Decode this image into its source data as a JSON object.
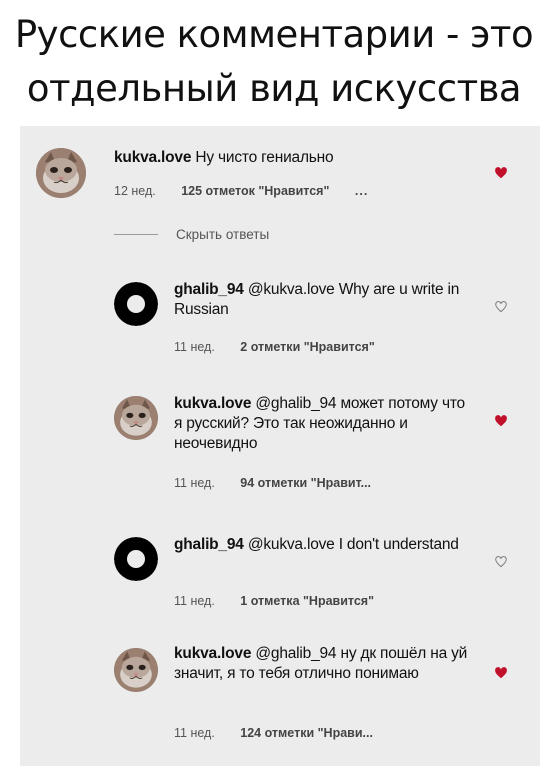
{
  "headline": {
    "line1": "Русские комментарии - это",
    "line2": "отдельный вид искусства"
  },
  "hide_replies_label": "Скрыть ответы",
  "comments": [
    {
      "username": "kukva.love",
      "text": "Ну чисто гениально",
      "time": "12 нед.",
      "likes": "125 отметок \"Нравится\"",
      "more": "...",
      "liked": true,
      "avatar": "cat-avatar"
    },
    {
      "username": "ghalib_94",
      "mention": "@kukva.love",
      "text": "Why are u write in Russian",
      "time": "11 нед.",
      "likes": "2 отметки \"Нравится\"",
      "liked": false,
      "avatar": "black-ring-avatar"
    },
    {
      "username": "kukva.love",
      "mention": "@ghalib_94",
      "text": "может потому что я русский? Это так неожиданно и неочевидно",
      "time": "11 нед.",
      "likes": "94 отметки \"Нравит...",
      "liked": true,
      "avatar": "cat-avatar"
    },
    {
      "username": "ghalib_94",
      "mention": "@kukva.love",
      "text": "I don't understand",
      "time": "11 нед.",
      "likes": "1 отметка \"Нравится\"",
      "liked": false,
      "avatar": "black-ring-avatar"
    },
    {
      "username": "kukva.love",
      "mention": "@ghalib_94",
      "text": "ну дк пошёл на  уй значит, я то тебя отлично понимаю",
      "time": "11 нед.",
      "likes": "124 отметки \"Нрави...",
      "liked": true,
      "avatar": "cat-avatar"
    }
  ],
  "colors": {
    "heart_liked": "#c0102a",
    "heart_outline": "#777777",
    "card_bg": "#ececec"
  }
}
